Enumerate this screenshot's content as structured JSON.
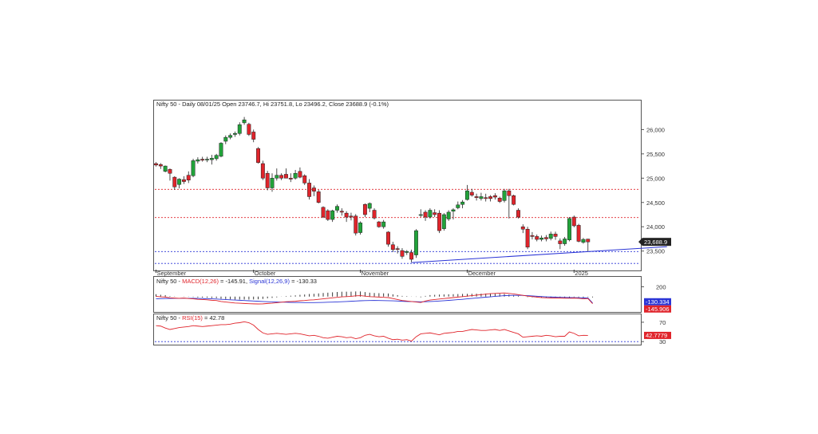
{
  "colors": {
    "up": "#21a33a",
    "down": "#e0242b",
    "trendline": "#2b35d6",
    "level_red": "#e0242b",
    "level_blue": "#2b35d6",
    "macd": "#e0242b",
    "signal": "#2b35d6",
    "rsi": "#e0242b",
    "price_tag_bg": "#222222",
    "signal_tag_bg": "#2b35d6",
    "macd_tag_bg": "#e0242b",
    "rsi_tag_bg": "#e0242b"
  },
  "chart_data": [
    {
      "type": "candlestick",
      "title": "Nifty 50 - Daily 08/01/25 Open 23746.7, Hi 23751.8, Lo 23496.2, Close 23688.9 (-0.1%)",
      "x_labels": [
        "September",
        "October",
        "November",
        "December",
        "2025"
      ],
      "x_label_index": [
        0,
        21,
        44,
        67,
        90
      ],
      "ylim": [
        23150,
        26450
      ],
      "yticks": [
        23500,
        24000,
        24500,
        25000,
        25500,
        26000
      ],
      "ytick_labels": [
        "23,500",
        "24,000",
        "24,500",
        "25,000",
        "25,500",
        "26,000"
      ],
      "last_price_label": "23,688.9",
      "candles": [
        {
          "o": 25300,
          "h": 25330,
          "l": 25240,
          "c": 25270
        },
        {
          "o": 25280,
          "h": 25310,
          "l": 25190,
          "c": 25250
        },
        {
          "o": 25140,
          "h": 25260,
          "l": 25120,
          "c": 25250
        },
        {
          "o": 25180,
          "h": 25200,
          "l": 24950,
          "c": 25100
        },
        {
          "o": 25020,
          "h": 25040,
          "l": 24760,
          "c": 24820
        },
        {
          "o": 24870,
          "h": 25000,
          "l": 24790,
          "c": 24980
        },
        {
          "o": 24970,
          "h": 25040,
          "l": 24880,
          "c": 24930
        },
        {
          "o": 25060,
          "h": 25140,
          "l": 24900,
          "c": 24960
        },
        {
          "o": 25050,
          "h": 25400,
          "l": 25020,
          "c": 25360
        },
        {
          "o": 25350,
          "h": 25430,
          "l": 25300,
          "c": 25380
        },
        {
          "o": 25390,
          "h": 25440,
          "l": 25340,
          "c": 25370
        },
        {
          "o": 25380,
          "h": 25440,
          "l": 25330,
          "c": 25390
        },
        {
          "o": 25380,
          "h": 25480,
          "l": 25280,
          "c": 25410
        },
        {
          "o": 25400,
          "h": 25500,
          "l": 25360,
          "c": 25470
        },
        {
          "o": 25450,
          "h": 25740,
          "l": 25430,
          "c": 25720
        },
        {
          "o": 25760,
          "h": 25880,
          "l": 25700,
          "c": 25840
        },
        {
          "o": 25840,
          "h": 25920,
          "l": 25800,
          "c": 25880
        },
        {
          "o": 25900,
          "h": 25960,
          "l": 25850,
          "c": 25920
        },
        {
          "o": 25920,
          "h": 26150,
          "l": 25880,
          "c": 26100
        },
        {
          "o": 26140,
          "h": 26260,
          "l": 26100,
          "c": 26200
        },
        {
          "o": 26110,
          "h": 26140,
          "l": 25870,
          "c": 25900
        },
        {
          "o": 25950,
          "h": 26000,
          "l": 25740,
          "c": 25800
        },
        {
          "o": 25610,
          "h": 25640,
          "l": 25300,
          "c": 25320
        },
        {
          "o": 25300,
          "h": 25360,
          "l": 24960,
          "c": 25000
        },
        {
          "o": 25100,
          "h": 25150,
          "l": 24750,
          "c": 24800
        },
        {
          "o": 24800,
          "h": 25100,
          "l": 24720,
          "c": 25000
        },
        {
          "o": 25000,
          "h": 25200,
          "l": 24950,
          "c": 25060
        },
        {
          "o": 25060,
          "h": 25100,
          "l": 24960,
          "c": 25000
        },
        {
          "o": 25080,
          "h": 25200,
          "l": 25000,
          "c": 25000
        },
        {
          "o": 25000,
          "h": 25100,
          "l": 24920,
          "c": 24980
        },
        {
          "o": 25000,
          "h": 25170,
          "l": 24970,
          "c": 25100
        },
        {
          "o": 25140,
          "h": 25220,
          "l": 25000,
          "c": 25020
        },
        {
          "o": 25050,
          "h": 25080,
          "l": 24860,
          "c": 24900
        },
        {
          "o": 24900,
          "h": 24980,
          "l": 24560,
          "c": 24620
        },
        {
          "o": 24800,
          "h": 24850,
          "l": 24630,
          "c": 24730
        },
        {
          "o": 24720,
          "h": 24760,
          "l": 24480,
          "c": 24500
        },
        {
          "o": 24400,
          "h": 24420,
          "l": 24180,
          "c": 24200
        },
        {
          "o": 24330,
          "h": 24360,
          "l": 24120,
          "c": 24150
        },
        {
          "o": 24150,
          "h": 24350,
          "l": 24100,
          "c": 24330
        },
        {
          "o": 24340,
          "h": 24460,
          "l": 24290,
          "c": 24420
        },
        {
          "o": 24320,
          "h": 24380,
          "l": 24230,
          "c": 24300
        },
        {
          "o": 24280,
          "h": 24320,
          "l": 24100,
          "c": 24200
        },
        {
          "o": 24220,
          "h": 24290,
          "l": 24130,
          "c": 24200
        },
        {
          "o": 24220,
          "h": 24260,
          "l": 23820,
          "c": 23870
        },
        {
          "o": 23880,
          "h": 24110,
          "l": 23840,
          "c": 24080
        },
        {
          "o": 24460,
          "h": 24480,
          "l": 24200,
          "c": 24250
        },
        {
          "o": 24380,
          "h": 24500,
          "l": 24300,
          "c": 24480
        },
        {
          "o": 24340,
          "h": 24380,
          "l": 24150,
          "c": 24180
        },
        {
          "o": 24100,
          "h": 24120,
          "l": 23980,
          "c": 24000
        },
        {
          "o": 24000,
          "h": 24140,
          "l": 23960,
          "c": 24100
        },
        {
          "o": 23890,
          "h": 23910,
          "l": 23590,
          "c": 23640
        },
        {
          "o": 23630,
          "h": 23690,
          "l": 23480,
          "c": 23530
        },
        {
          "o": 23550,
          "h": 23600,
          "l": 23450,
          "c": 23540
        },
        {
          "o": 23510,
          "h": 23560,
          "l": 23340,
          "c": 23390
        },
        {
          "o": 23470,
          "h": 23520,
          "l": 23420,
          "c": 23490
        },
        {
          "o": 23470,
          "h": 23530,
          "l": 23270,
          "c": 23330
        },
        {
          "o": 23420,
          "h": 23950,
          "l": 23360,
          "c": 23920
        },
        {
          "o": 24250,
          "h": 24360,
          "l": 24200,
          "c": 24250
        },
        {
          "o": 24300,
          "h": 24340,
          "l": 24120,
          "c": 24200
        },
        {
          "o": 24200,
          "h": 24380,
          "l": 24170,
          "c": 24340
        },
        {
          "o": 24290,
          "h": 24360,
          "l": 24200,
          "c": 24250
        },
        {
          "o": 24280,
          "h": 24340,
          "l": 23870,
          "c": 23920
        },
        {
          "o": 23960,
          "h": 24280,
          "l": 23920,
          "c": 24250
        },
        {
          "o": 24160,
          "h": 24340,
          "l": 24120,
          "c": 24300
        },
        {
          "o": 24320,
          "h": 24380,
          "l": 24150,
          "c": 24350
        },
        {
          "o": 24390,
          "h": 24520,
          "l": 24360,
          "c": 24450
        },
        {
          "o": 24460,
          "h": 24550,
          "l": 24380,
          "c": 24510
        },
        {
          "o": 24560,
          "h": 24860,
          "l": 24540,
          "c": 24740
        },
        {
          "o": 24710,
          "h": 24780,
          "l": 24620,
          "c": 24650
        },
        {
          "o": 24620,
          "h": 24680,
          "l": 24540,
          "c": 24600
        },
        {
          "o": 24580,
          "h": 24700,
          "l": 24540,
          "c": 24620
        },
        {
          "o": 24600,
          "h": 24680,
          "l": 24520,
          "c": 24580
        },
        {
          "o": 24620,
          "h": 24650,
          "l": 24520,
          "c": 24580
        },
        {
          "o": 24640,
          "h": 24690,
          "l": 24560,
          "c": 24610
        },
        {
          "o": 24590,
          "h": 24620,
          "l": 24490,
          "c": 24520
        },
        {
          "o": 24540,
          "h": 24780,
          "l": 24500,
          "c": 24740
        },
        {
          "o": 24740,
          "h": 24780,
          "l": 24170,
          "c": 24640
        },
        {
          "o": 24640,
          "h": 24660,
          "l": 24440,
          "c": 24460
        },
        {
          "o": 24340,
          "h": 24380,
          "l": 24170,
          "c": 24200
        },
        {
          "o": 24000,
          "h": 24050,
          "l": 23870,
          "c": 23950
        },
        {
          "o": 23950,
          "h": 24000,
          "l": 23540,
          "c": 23580
        },
        {
          "o": 23820,
          "h": 23890,
          "l": 23740,
          "c": 23800
        },
        {
          "o": 23800,
          "h": 23840,
          "l": 23700,
          "c": 23740
        },
        {
          "o": 23740,
          "h": 23820,
          "l": 23700,
          "c": 23770
        },
        {
          "o": 23780,
          "h": 23830,
          "l": 23700,
          "c": 23750
        },
        {
          "o": 23760,
          "h": 23900,
          "l": 23720,
          "c": 23850
        },
        {
          "o": 23850,
          "h": 23900,
          "l": 23730,
          "c": 23800
        },
        {
          "o": 23710,
          "h": 23760,
          "l": 23540,
          "c": 23650
        },
        {
          "o": 23650,
          "h": 23790,
          "l": 23610,
          "c": 23750
        },
        {
          "o": 23730,
          "h": 24200,
          "l": 23700,
          "c": 24170
        },
        {
          "o": 24200,
          "h": 24230,
          "l": 23990,
          "c": 24020
        },
        {
          "o": 24030,
          "h": 24060,
          "l": 23680,
          "c": 23700
        },
        {
          "o": 23680,
          "h": 23770,
          "l": 23650,
          "c": 23740
        },
        {
          "o": 23746.7,
          "h": 23751.8,
          "l": 23496.2,
          "c": 23688.9
        }
      ],
      "levels": [
        {
          "value": 24770,
          "style": "dashed",
          "color_key": "level_red"
        },
        {
          "value": 24190,
          "style": "dashed",
          "color_key": "level_red"
        },
        {
          "value": 23490,
          "style": "dashed",
          "color_key": "level_blue"
        },
        {
          "value": 23245,
          "style": "dashed",
          "color_key": "level_blue"
        }
      ],
      "trendline": {
        "x1": 55,
        "y1": 23263,
        "x2": 110,
        "y2": 23590
      }
    },
    {
      "type": "line",
      "title_prefix": "Nifty 50 - ",
      "title_macd": "MACD(12,26)",
      "title_macd_value": " = -145.91, ",
      "title_signal": "Signal(12,26,9)",
      "title_signal_value": " = -130.33",
      "ylim": [
        -280,
        240
      ],
      "yticks": [
        200
      ],
      "ytick_labels": [
        "200"
      ],
      "signal_label": "-130.334",
      "macd_label": "-145.906",
      "series": [
        {
          "name": "MACD(12,26)",
          "values": [
            5,
            -5,
            -10,
            -25,
            -30,
            -35,
            -30,
            -40,
            -45,
            -55,
            -60,
            -65,
            -75,
            -80,
            -100,
            -110,
            -120,
            -130,
            -135,
            -140,
            -145,
            -148,
            -150,
            -148,
            -140,
            -135,
            -125,
            -115,
            -105,
            -100,
            -95,
            -85,
            -80,
            -70,
            -65,
            -55,
            -45,
            -35,
            -25,
            -15,
            -5,
            0,
            5,
            15,
            20,
            10,
            0,
            -5,
            -10,
            -15,
            -20,
            -40,
            -60,
            -80,
            -90,
            -100,
            -110,
            -120,
            -90,
            -70,
            -60,
            -50,
            -40,
            -30,
            -20,
            -10,
            0,
            10,
            20,
            30,
            40,
            50,
            60,
            65,
            70,
            75,
            65,
            55,
            40,
            25,
            10,
            0,
            -10,
            -20,
            -25,
            -28,
            -30,
            -30,
            -32,
            -33,
            -30,
            -35,
            -45,
            -40,
            -146
          ]
        },
        {
          "name": "Signal(12,26,9)",
          "values": [
            -45,
            -42,
            -40,
            -38,
            -36,
            -35,
            -34,
            -35,
            -36,
            -38,
            -40,
            -43,
            -46,
            -50,
            -55,
            -60,
            -65,
            -70,
            -75,
            -80,
            -85,
            -90,
            -95,
            -100,
            -105,
            -108,
            -110,
            -112,
            -115,
            -118,
            -120,
            -121,
            -122,
            -123,
            -122,
            -120,
            -118,
            -115,
            -112,
            -108,
            -104,
            -100,
            -95,
            -90,
            -85,
            -82,
            -80,
            -79,
            -80,
            -82,
            -84,
            -86,
            -90,
            -95,
            -100,
            -103,
            -105,
            -106,
            -104,
            -101,
            -96,
            -90,
            -84,
            -77,
            -70,
            -62,
            -55,
            -46,
            -38,
            -29,
            -20,
            -12,
            -4,
            5,
            12,
            20,
            24,
            26,
            26,
            24,
            20,
            14,
            8,
            2,
            -4,
            -8,
            -12,
            -15,
            -18,
            -20,
            -21,
            -23,
            -26,
            -30,
            -130
          ]
        },
        {
          "name": "Histogram",
          "values": [
            50,
            37,
            30,
            13,
            6,
            0,
            4,
            -5,
            -9,
            -17,
            -20,
            -22,
            -29,
            -30,
            -45,
            -50,
            -55,
            -60,
            -60,
            -60,
            -60,
            -58,
            -55,
            -48,
            -35,
            -27,
            -15,
            -3,
            10,
            18,
            25,
            36,
            42,
            53,
            57,
            65,
            73,
            80,
            87,
            93,
            99,
            100,
            100,
            105,
            105,
            92,
            80,
            74,
            70,
            67,
            64,
            46,
            30,
            15,
            10,
            3,
            -5,
            -14,
            14,
            31,
            36,
            40,
            44,
            47,
            50,
            52,
            55,
            56,
            58,
            59,
            60,
            62,
            64,
            60,
            58,
            55,
            41,
            29,
            14,
            1,
            -10,
            -14,
            -18,
            -22,
            -21,
            -20,
            -18,
            -15,
            -14,
            -13,
            -9,
            -12,
            -19,
            -10,
            -16
          ]
        }
      ]
    },
    {
      "type": "line",
      "title_prefix": "Nifty 50 - ",
      "title_rsi": "RSI(15)",
      "title_rsi_value": " = 42.78",
      "ylim": [
        27,
        83
      ],
      "yticks": [
        70,
        30
      ],
      "ytick_labels": [
        "70",
        "30"
      ],
      "rsi_label": "42.7779",
      "reference_line": 30,
      "series": [
        {
          "name": "RSI(15)",
          "values": [
            63,
            62,
            58,
            55,
            57,
            59,
            60,
            61,
            63,
            62,
            61,
            62,
            63,
            64,
            65,
            65,
            66,
            68,
            69,
            71,
            69,
            64,
            55,
            48,
            45,
            46,
            47,
            46,
            45,
            46,
            47,
            46,
            44,
            42,
            43,
            41,
            38,
            37,
            39,
            41,
            40,
            38,
            39,
            36,
            38,
            43,
            45,
            42,
            40,
            41,
            37,
            34,
            35,
            33,
            34,
            31,
            40,
            46,
            47,
            48,
            46,
            44,
            47,
            48,
            49,
            51,
            51,
            53,
            55,
            54,
            53,
            53,
            54,
            55,
            53,
            55,
            52,
            49,
            46,
            39,
            40,
            41,
            42,
            41,
            43,
            42,
            40,
            41,
            41,
            50,
            47,
            42,
            43,
            42.78
          ]
        }
      ]
    }
  ]
}
